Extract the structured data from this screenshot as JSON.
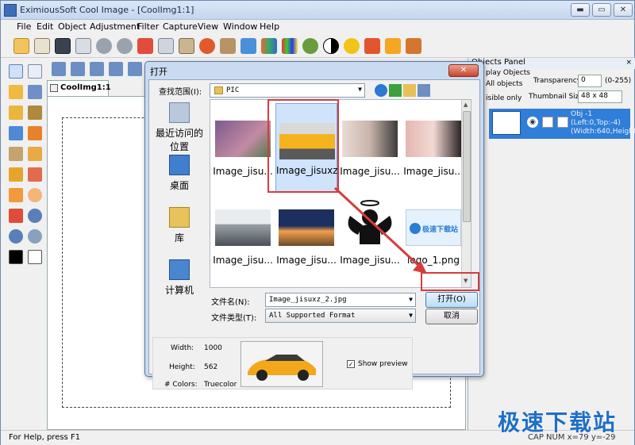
{
  "app": {
    "title": "EximiousSoft Cool Image - [CoolImg1:1]",
    "menu": [
      "File",
      "Edit",
      "Object",
      "Adjustment",
      "Filter",
      "Capture",
      "View",
      "Window",
      "Help"
    ],
    "doc_tab": "CoolImg1:1",
    "status_left": "For Help, press F1",
    "status_right": "CAP  NUM   x=79 y=-29",
    "watermark": "极速下载站"
  },
  "objects_panel": {
    "title": "Objects Panel",
    "close": "×",
    "display_objects": "play Objects",
    "all_objects": "All objects",
    "visible_only": "isible only",
    "transparency_label": "Transparency:",
    "transparency_value": "0",
    "transparency_range": "(0-255)",
    "thumb_size_label": "Thumbnail Size:",
    "thumb_size_value": "48 x 48",
    "object": {
      "line1": "Obj -1",
      "line2": "(Left:0,Top:-4)",
      "line3": "(Width:640,Height:4"
    }
  },
  "dialog": {
    "title": "打开",
    "lookin_label": "查找范围(I):",
    "lookin_value": "PIC",
    "places": [
      "最近访问的位置",
      "桌面",
      "库",
      "计算机"
    ],
    "files": [
      {
        "name": "Image_jisu...",
        "color_a": "#7d5a8c",
        "color_b": "#c38ba4"
      },
      {
        "name": "Image_jisuxz_2.jpg",
        "color_a": "#f5b31e",
        "color_b": "#5a5a5a"
      },
      {
        "name": "Image_jisu...",
        "color_a": "#e9dcd6",
        "color_b": "#3d3a3a"
      },
      {
        "name": "Image_jisu...",
        "color_a": "#e4b7b0",
        "color_b": "#2b2424"
      },
      {
        "name": "Image_jisu...",
        "color_a": "#9aa1a8",
        "color_b": "#e8ecef"
      },
      {
        "name": "Image_jisu...",
        "color_a": "#1d2f5e",
        "color_b": "#f2a04b"
      },
      {
        "name": "Image_jisu...",
        "color_a": "#111111",
        "color_b": "#ffffff"
      },
      {
        "name": "logo_1.png",
        "color_a": "#2a7dd4",
        "color_b": "#e5f1fc"
      }
    ],
    "logo_caption": "极速下载站",
    "filename_label": "文件名(N):",
    "filename_value": "Image_jisuxz_2.jpg",
    "filetype_label": "文件类型(T):",
    "filetype_value": "All Supported Format",
    "open_button": "打开(O)",
    "cancel_button": "取消",
    "preview": {
      "width_label": "Width:",
      "width_value": "1000",
      "height_label": "Height:",
      "height_value": "562",
      "colors_label": "# Colors:",
      "colors_value": "Truecolor",
      "show_preview": "Show preview"
    }
  }
}
